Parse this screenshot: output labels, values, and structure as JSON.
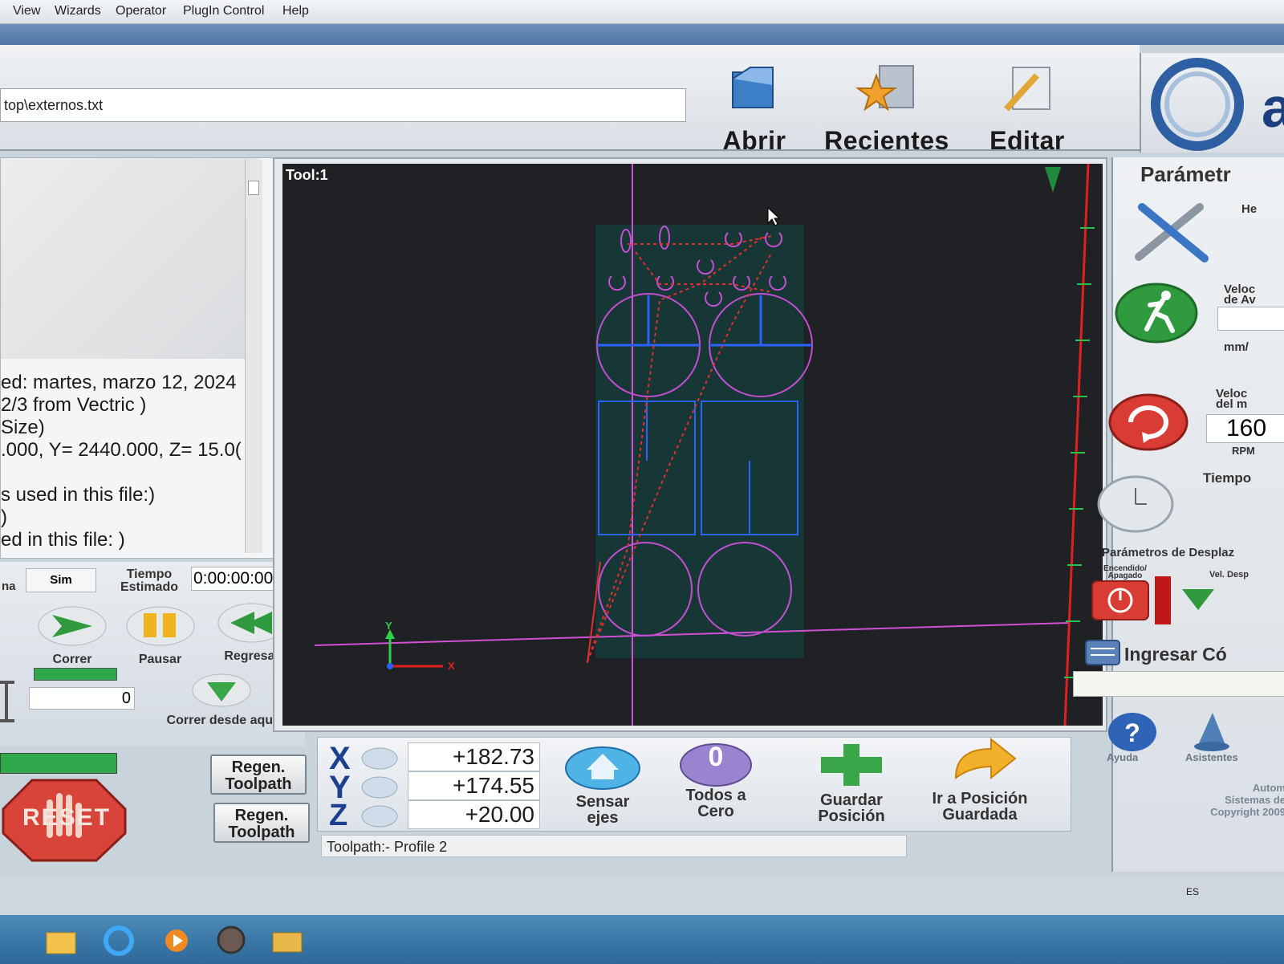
{
  "menu": [
    "View",
    "Wizards",
    "Operator",
    "PlugIn Control",
    "Help"
  ],
  "file": {
    "path": "top\\externos.txt"
  },
  "toolbar": {
    "open": "Abrir",
    "recent": "Recientes",
    "edit": "Editar"
  },
  "gcode": {
    "lines": [
      "ed: martes, marzo 12, 2024",
      "2/3 from Vectric )",
      "Size)",
      ".000, Y= 2440.000, Z= 15.0(",
      "",
      "s used in this file:)",
      ")",
      "ed in this file: )"
    ]
  },
  "run": {
    "sim_label": "Sim",
    "est_time_label_1": "Tiempo",
    "est_time_label_2": "Estimado",
    "est_time_value": "0:00:00:00",
    "left_stub": "na",
    "run": "Correr",
    "pause": "Pausar",
    "rewind": "Regresar",
    "line_value": "0",
    "run_from_here": "Correr desde aquí",
    "regen1_a": "Regen.",
    "regen1_b": "Toolpath",
    "regen2_a": "Regen.",
    "regen2_b": "Toolpath",
    "reset": "RESET"
  },
  "viewport": {
    "tool_label": "Tool:1",
    "axis_x": "X",
    "axis_y": "Y"
  },
  "dro": {
    "x_label": "X",
    "x_value": "+182.73",
    "y_label": "Y",
    "y_value": "+174.55",
    "z_label": "Z",
    "z_value": "+20.00",
    "home_1": "Sensar",
    "home_2": "ejes",
    "zero_1": "Todos a",
    "zero_2": "Cero",
    "zero_icon": "0",
    "save_1": "Guardar",
    "save_2": "Posición",
    "goto_1": "Ir a Posición",
    "goto_2": "Guardada"
  },
  "status": {
    "toolpath": "Toolpath:- Profile 2"
  },
  "right": {
    "params": "Parámetr",
    "he": "He",
    "feed_1": "Veloc",
    "feed_2": "de Av",
    "feed_unit": "mm/",
    "spindle_1": "Veloc",
    "spindle_2": "del m",
    "spindle_value": "160",
    "spindle_unit": "RPM",
    "time": "Tiempo",
    "jog_params": "Parámetros de Desplaz",
    "onoff_1": "Encendido/",
    "onoff_2": "Apagado",
    "jog_speed": "Vel. Desp",
    "mdi": "Ingresar Có",
    "help": "Ayuda",
    "wizards": "Asistentes",
    "credit_1": "Autom",
    "credit_2": "Sistemas de",
    "credit_3": "Copyright 2009"
  },
  "tray": {
    "lang": "ES"
  }
}
